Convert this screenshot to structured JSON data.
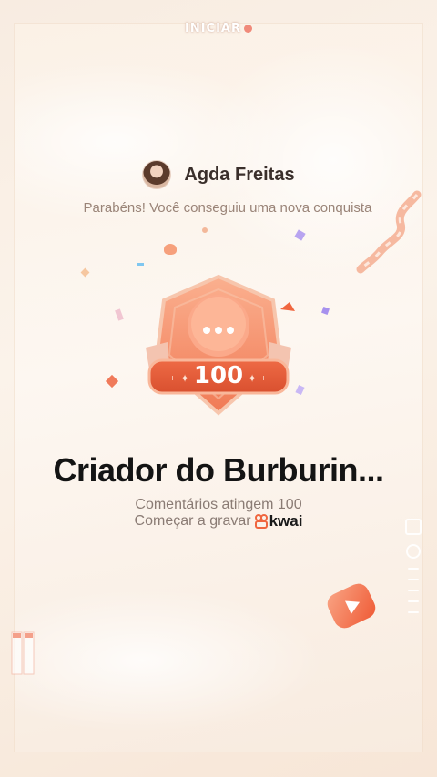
{
  "top_label": "INICIAR",
  "user": {
    "name": "Agda Freitas"
  },
  "congrats_text": "Parabéns! Você conseguiu uma nova conquista",
  "badge": {
    "value": "100"
  },
  "achievement": {
    "title": "Criador do Burburin...",
    "subtitle": "Comentários atingem 100",
    "record_label": "Começar a gravar",
    "brand": "kwai"
  },
  "colors": {
    "accent": "#f0663f",
    "badge_light": "#f9a382",
    "title": "#141414",
    "muted": "#8a7b74"
  },
  "icons": {
    "play": "play-icon",
    "kwai": "kwai-logo-icon",
    "chat": "chat-bubble-icon"
  }
}
